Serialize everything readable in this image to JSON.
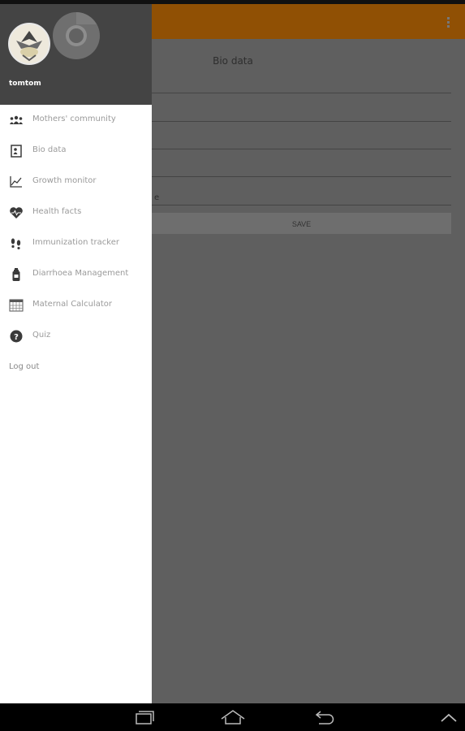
{
  "app": {
    "page_title": "Bio data",
    "partial_field_text": "e",
    "save_label": "SAVE"
  },
  "drawer": {
    "user_name": "tomtom",
    "items": [
      {
        "label": "Mothers' community",
        "icon": "community-icon"
      },
      {
        "label": "Bio data",
        "icon": "bio-data-icon"
      },
      {
        "label": "Growth monitor",
        "icon": "growth-chart-icon"
      },
      {
        "label": "Health facts",
        "icon": "heart-icon"
      },
      {
        "label": "Immunization tracker",
        "icon": "footprints-icon"
      },
      {
        "label": "Diarrhoea Management",
        "icon": "bottle-icon"
      },
      {
        "label": "Maternal Calculator",
        "icon": "calendar-icon"
      },
      {
        "label": "Quiz",
        "icon": "help-icon"
      }
    ],
    "logout_label": "Log out"
  },
  "colors": {
    "app_bar": "#905004",
    "drawer_header": "#444444",
    "scrim": "#5f5f5f"
  }
}
